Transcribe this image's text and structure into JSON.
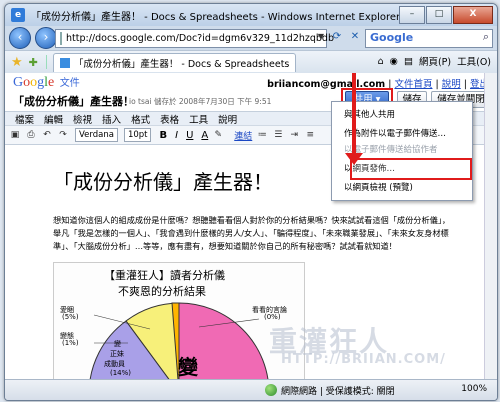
{
  "window": {
    "title": "「成份分析儀」產生器！ - Docs & Spreadsheets - Windows Internet Explorer",
    "controls": {
      "minimize": "–",
      "maximize": "□",
      "close": "X"
    }
  },
  "navigation": {
    "url": "http://docs.google.com/Doc?id=dgm6v329_11d2hzqbdb",
    "search_placeholder": "Google"
  },
  "favorites": {
    "tab_label": "「成份分析儀」產生器！ - Docs & Spreadsheets",
    "tools": {
      "page": "網頁(P)",
      "tools": "工具(O)"
    }
  },
  "gdocs": {
    "logo_letters": [
      "G",
      "o",
      "o",
      "g",
      "l",
      "e"
    ],
    "logo_sub": "文件",
    "user": {
      "email": "briiancom@gmail.com",
      "links": [
        "文件首頁",
        "說明",
        "登出"
      ]
    },
    "doc_title": "「成份分析儀」產生器！",
    "saved_note": "io tsai 儲存於 2008年7月30日 下午 9:51",
    "buttons": {
      "share": "共用 ▾",
      "save": "儲存",
      "save_close": "儲存並關閉"
    },
    "menu": [
      "檔案",
      "編輯",
      "檢視",
      "插入",
      "格式",
      "表格",
      "工具",
      "說明"
    ],
    "toolbar": {
      "font": "Verdana",
      "size": "10pt",
      "bold": "B",
      "italic": "I",
      "underline": "U",
      "link": "連結",
      "color": "A"
    },
    "share_menu": [
      {
        "label": "與其他人共用",
        "enabled": true
      },
      {
        "label": "作為附件以電子郵件傳送…",
        "enabled": true
      },
      {
        "label": "以電子郵件傳送給協作者",
        "enabled": false
      },
      {
        "label": "以網頁發佈…",
        "enabled": true
      },
      {
        "label": "以網頁檢視 (預覽)",
        "enabled": true
      }
    ]
  },
  "document": {
    "heading": "「成份分析儀」產生器！",
    "paragraph": "想知道你這個人的組成成份是什麼嗎？想聽聽看看個人對於你的分析結果嗎？快來試試看這個「成份分析儀」，舉凡「我是怎樣的一個人」、「我會遇到什麼樣的男人/女人」、「騙得程度」、「未來職業發展」、「未來女友身材標準」、「大腦成份分析」…等等，應有盡有，想要知道關於你自己的所有秘密嗎？試試看就知道！",
    "chart": {
      "title1": "【重灌狂人】讀者分析儀",
      "title2": "不爽恩的分析結果",
      "labels": [
        "愛睏",
        "(5%)",
        "變態",
        "(1%)",
        "變",
        "正妹",
        "成動員",
        "(14%)",
        "看看的言論",
        "(0%)",
        "變"
      ]
    },
    "watermark": "重灌狂人",
    "watermark_url": "HTTP://BRIIAN.COM/"
  },
  "status": {
    "zone": "網際網路 | 受保護模式: 關閉",
    "zoom": "100%"
  }
}
